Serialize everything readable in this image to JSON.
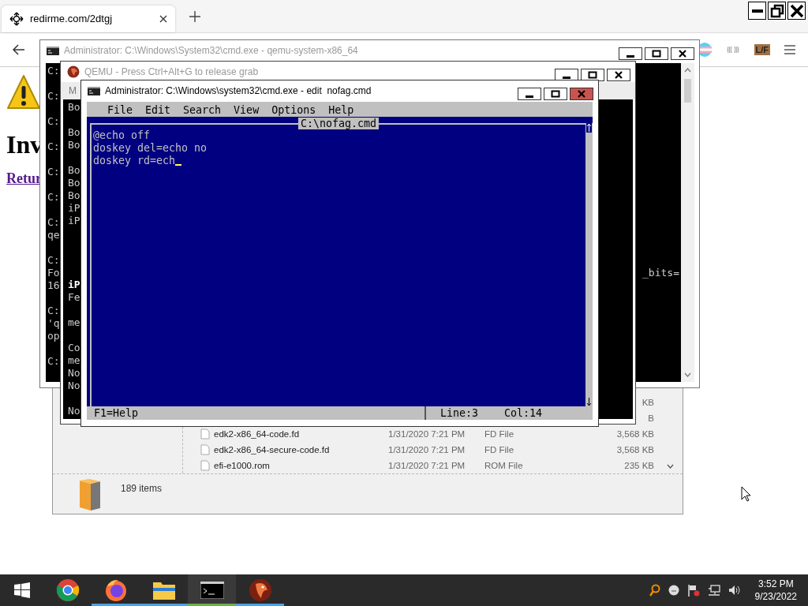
{
  "browser": {
    "tab": {
      "title": "redirme.com/2dtgj",
      "selected": true
    },
    "extension_label": "L/F",
    "page": {
      "heading": "Inv",
      "link": "Retur"
    }
  },
  "cmd_window": {
    "title": "Administrator: C:\\Windows\\System32\\cmd.exe - qemu-system-x86_64",
    "active": false,
    "blocks": [
      [
        {
          "text": "C:"
        }
      ],
      [
        {
          "text": "C:"
        }
      ],
      [
        {
          "text": "C:"
        }
      ],
      [
        {
          "text": "C:"
        }
      ],
      [
        {
          "text": "C:"
        }
      ],
      [
        {
          "text": "C:"
        }
      ],
      [
        {
          "text": "C:"
        },
        {
          "text": "qe"
        }
      ],
      [
        {
          "text": "C:"
        },
        {
          "text": "Fo",
          "tail": "_bits="
        },
        {
          "text": "16"
        }
      ],
      [
        {
          "text": "C:"
        },
        {
          "text": "'q"
        },
        {
          "text": "op"
        }
      ],
      [
        {
          "text": "C:"
        }
      ]
    ]
  },
  "qemu_window": {
    "title": "QEMU - Press Ctrl+Alt+G to release grab",
    "active": false,
    "menu_label": "M",
    "top_blocks": [
      [
        {
          "text": "Bo",
          "bold": false
        }
      ],
      [
        {
          "text": "Bo",
          "bold": false
        },
        {
          "text": "Bo",
          "bold": false
        }
      ],
      [
        {
          "text": "Bo",
          "bold": false
        },
        {
          "text": "Bo",
          "bold": false
        },
        {
          "text": "Bo",
          "bold": false
        },
        {
          "text": "iP",
          "bold": false
        },
        {
          "text": "iP",
          "bold": false
        }
      ]
    ],
    "bottom_blocks": [
      [
        {
          "text": "iP",
          "bold": true
        },
        {
          "text": "Fe",
          "bold": false
        }
      ],
      [
        {
          "text": "me",
          "bold": false
        }
      ],
      [
        {
          "text": "Co",
          "bold": false
        },
        {
          "text": "me",
          "bold": false
        },
        {
          "text": "No",
          "bold": false
        },
        {
          "text": "No",
          "bold": false
        }
      ],
      [
        {
          "text": "No",
          "bold": false
        }
      ]
    ]
  },
  "edit_window": {
    "title": "Administrator: C:\\Windows\\system32\\cmd.exe - edit  nofag.cmd",
    "active": true,
    "menu": [
      "File",
      "Edit",
      "Search",
      "View",
      "Options",
      "Help"
    ],
    "file_title": "C:\\nofag.cmd",
    "lines": [
      "@echo off",
      "doskey del=echo no",
      "doskey rd=ech"
    ],
    "cursor_visible": true,
    "status": {
      "help": "F1=Help",
      "line": "Line:3",
      "col": "Col:14"
    }
  },
  "explorer": {
    "rows": [
      {
        "size": "KB"
      },
      {
        "size": "B"
      },
      {
        "name": "edk2-x86_64-code.fd",
        "date": "1/31/2020 7:21 PM",
        "type": "FD File",
        "size": "3,568 KB"
      },
      {
        "name": "edk2-x86_64-secure-code.fd",
        "date": "1/31/2020 7:21 PM",
        "type": "FD File",
        "size": "3,568 KB"
      },
      {
        "name": "efi-e1000.rom",
        "date": "1/31/2020 7:21 PM",
        "type": "ROM File",
        "size": "235 KB"
      }
    ],
    "status": "189 items"
  },
  "taskbar": {
    "apps": [
      {
        "kind": "chrome",
        "running": false,
        "active": false
      },
      {
        "kind": "firefox",
        "running": true,
        "active": false
      },
      {
        "kind": "explorer",
        "running": true,
        "active": false
      },
      {
        "kind": "cmd",
        "running": true,
        "active": true
      },
      {
        "kind": "qemu",
        "running": true,
        "active": false
      }
    ],
    "time": "3:52 PM",
    "date": "9/23/2022"
  }
}
